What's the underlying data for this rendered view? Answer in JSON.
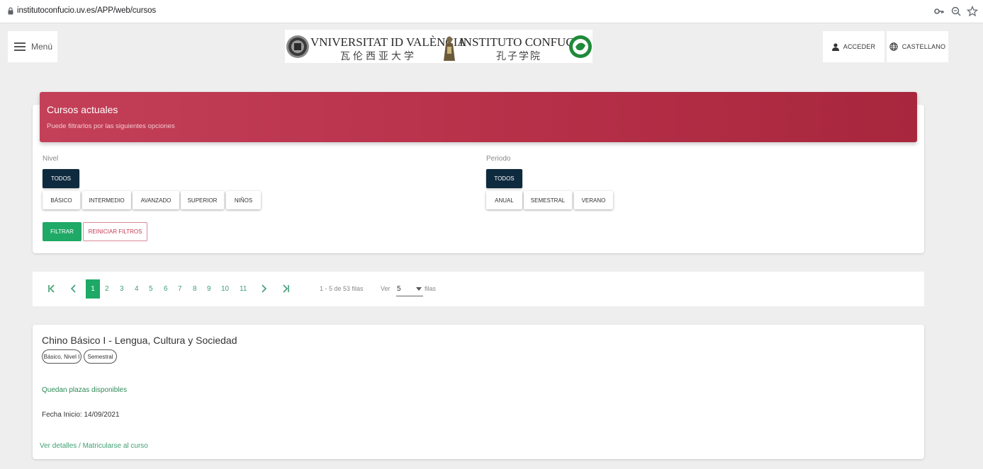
{
  "browser": {
    "url": "institutoconfucio.uv.es/APP/web/cursos"
  },
  "header": {
    "menu_label": "Menú",
    "logo": {
      "uv_name": "VNIVERSITAT ID VALÈNCIA",
      "uv_chinese": "瓦伦西亚大学",
      "ic_name": "INSTITUTO CONFUCIO",
      "ic_chinese": "孔子学院"
    },
    "login_label": "ACCEDER",
    "language_label": "CASTELLANO"
  },
  "filters": {
    "title": "Cursos actuales",
    "subtitle": "Puede filtrarlos por las siguientes opciones",
    "nivel": {
      "label": "Nivel",
      "all_label": "TODOS",
      "options": [
        "BÁSICO",
        "INTERMEDIO",
        "AVANZADO",
        "SUPERIOR",
        "NIÑOS"
      ]
    },
    "periodo": {
      "label": "Periodo",
      "all_label": "TODOS",
      "options": [
        "ANUAL",
        "SEMESTRAL",
        "VERANO"
      ]
    },
    "filter_button": "FILTRAR",
    "reset_button": "REINICIAR FILTROS"
  },
  "pagination": {
    "first": "|<",
    "prev": "<",
    "current": "1",
    "pages": [
      "2",
      "3",
      "4",
      "5",
      "6",
      "7",
      "8",
      "9",
      "10",
      "11"
    ],
    "next": ">",
    "last": ">|",
    "rows_info": "1 - 5 de 53 filas",
    "ver_label": "Ver",
    "rows_per_page": "5",
    "filas_label": "filas"
  },
  "course": {
    "title": "Chino Básico I - Lengua, Cultura y Sociedad",
    "tags": [
      "Básico, Nivel I",
      "Semestral"
    ],
    "availability": "Quedan plazas disponibles",
    "start_date": "Fecha Inicio: 14/09/2021",
    "links": "Ver detalles / Matricularse al curso"
  },
  "colors": {
    "header_red": "#b63048",
    "dark_chip": "#0e2a3e",
    "green": "#1ea966",
    "link_green": "#3e9f73"
  }
}
